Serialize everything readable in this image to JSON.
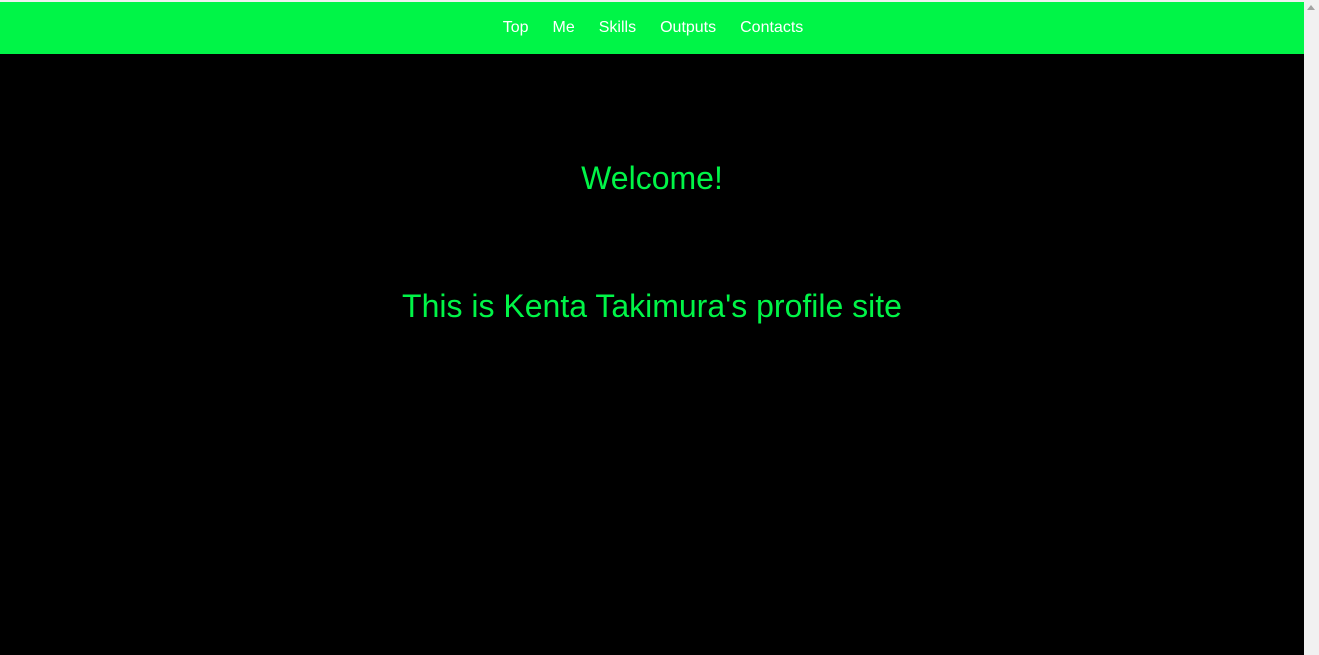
{
  "nav": {
    "items": [
      {
        "label": "Top"
      },
      {
        "label": "Me"
      },
      {
        "label": "Skills"
      },
      {
        "label": "Outputs"
      },
      {
        "label": "Contacts"
      }
    ]
  },
  "hero": {
    "welcome": "Welcome!",
    "subtitle": "This is Kenta Takimura's profile site"
  },
  "colors": {
    "accent": "#00f547",
    "background": "#000000",
    "nav_text": "#ffffff"
  },
  "icons": {
    "scroll_up": "scroll-up-arrow-icon"
  }
}
